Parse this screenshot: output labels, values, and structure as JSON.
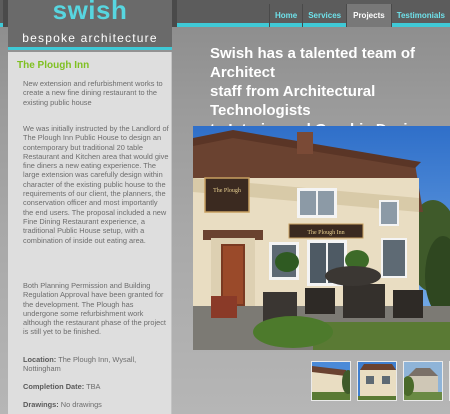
{
  "logo": {
    "word": "swish",
    "tagline": "bespoke architecture"
  },
  "nav": [
    "Home",
    "Services",
    "Projects",
    "Testimonials"
  ],
  "nav_active": "Projects",
  "hero": "Swish has a talented team of Architect\nstaff from Architectural Technologists\nto Interior and Graphic Designers",
  "project": {
    "title": "The Plough Inn",
    "intro": "New extension and refurbishment works to create a new fine dining restaurant to the existing public house",
    "para1": "We was initially instructed by the Landlord of The Plough Inn Public House to design an contemporary but traditional 20 table Restaurant and Kitchen area that would give fine diners a new eating experience. The large extension was carefully design within character of the existing public house to the requirements of our client, the planners, the conservation officer and most importantly the end users. The proposal included a new Fine Dining Restaurant experience, a traditional Public House setup, with a combination of inside out eating area.",
    "para2": "Both Planning Permission and Building Regulation Approval have been granted for the development. The Plough has undergone some refurbishment work although the restaurant phase of the project is still yet to be finished.",
    "location_label": "Location:",
    "location_value": "The Plough Inn, Wysall, Nottingham",
    "completion_label": "Completion Date:",
    "completion_value": "TBA",
    "drawings_label": "Drawings:",
    "drawings_value": "No drawings"
  },
  "photo": {
    "sign_text": "The Plough",
    "sign_text_2": "The Plough Inn"
  },
  "thumbnails_count": 3,
  "colors": {
    "accent": "#3fc9d6",
    "title_green": "#7fc021",
    "panel": "#dedede",
    "topbar": "#5c5c5c"
  }
}
